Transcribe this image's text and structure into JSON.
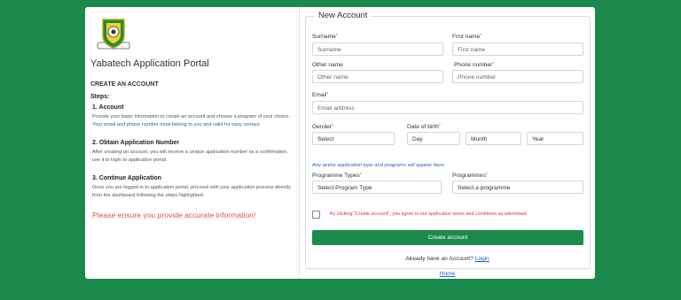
{
  "app": {
    "title": "Yabatech Application Portal"
  },
  "left": {
    "create_heading": "CREATE AN ACCOUNT",
    "steps_label": "Steps:",
    "steps": [
      {
        "title": "1. Account",
        "text": "Provide your basic information to create an account and choose a program of your choice.",
        "highlight": "Your email and phone number must belong to you and valid for easy contact."
      },
      {
        "title": "2. Obtain Application Number",
        "text": "After creating an account, you will receive a unique application number as a confirmation, use it to login to application portal."
      },
      {
        "title": "3. Continue Application",
        "text": "Once you are logged in to application portal, proceed with your application process directly from the dashboard following the steps highlighted."
      }
    ],
    "warning": "Please ensure you provide accurate information!"
  },
  "form": {
    "legend": "New Account",
    "surname": {
      "label": "Surname",
      "placeholder": "Surname"
    },
    "first_name": {
      "label": "First name",
      "placeholder": "First name"
    },
    "other_name": {
      "label": "Other name",
      "placeholder": "Other name"
    },
    "phone": {
      "label": "Phone number",
      "placeholder": "Phone number"
    },
    "email": {
      "label": "Email",
      "placeholder": "Email address"
    },
    "gender": {
      "label": "Gender",
      "value": "Select"
    },
    "dob": {
      "label": "Date of birth",
      "day": "Day",
      "month": "Month",
      "year": "Year"
    },
    "hint": "Any active application type and programs will appear here.",
    "programme_type": {
      "label": "Programme Types",
      "value": "Select Program Type"
    },
    "programmes": {
      "label": "Programmes",
      "value": "Select a programme"
    },
    "terms": "By clicking \"Create account\", you agree to our application terms and conditions as advertised.",
    "create_button": "Create account",
    "already_text": "Already have an Account?",
    "login_link": "Login",
    "home_link": "Home"
  },
  "colors": {
    "brand": "#1c8a4c",
    "link": "#2563c4",
    "warning": "#e05050"
  },
  "icons": {
    "logo": "yabatech-crest-logo"
  }
}
